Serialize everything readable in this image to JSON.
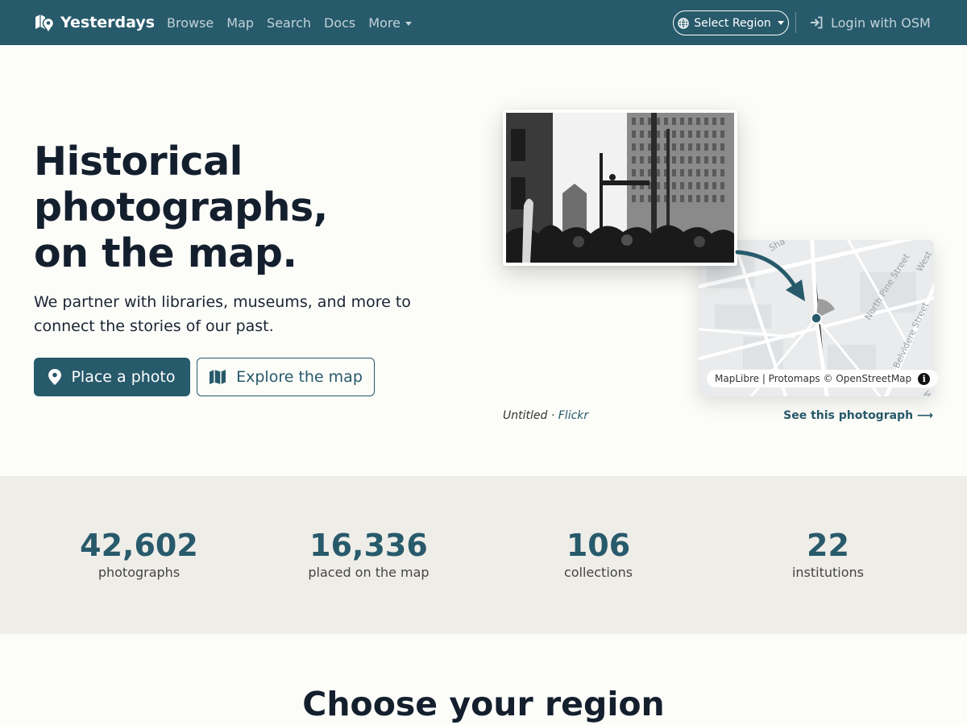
{
  "navbar": {
    "brand": "Yesterdays",
    "links": [
      "Browse",
      "Map",
      "Search",
      "Docs",
      "More"
    ],
    "region_button": "Select Region",
    "login": "Login with OSM"
  },
  "hero": {
    "title_line1": "Historical",
    "title_line2": "photographs,",
    "title_line3": "on the map.",
    "subtitle": "We partner with libraries, museums, and more to connect the stories of our past.",
    "primary_button": "Place a photo",
    "secondary_button": "Explore the map"
  },
  "feature": {
    "photo_title": "Untitled",
    "separator": " · ",
    "source": "Flickr",
    "see_link": "See this photograph ⟶",
    "map_attribution": "MapLibre | Protomaps © OpenStreetMap",
    "street_labels": [
      "North Pine Street",
      "Belvidere Street",
      "West",
      "West",
      "Sha"
    ]
  },
  "stats": [
    {
      "value": "42,602",
      "label": "photographs"
    },
    {
      "value": "16,336",
      "label": "placed on the map"
    },
    {
      "value": "106",
      "label": "collections"
    },
    {
      "value": "22",
      "label": "institutions"
    }
  ],
  "regions": {
    "title": "Choose your region"
  },
  "colors": {
    "brand": "#275a6b",
    "background": "#fcfcf9",
    "stats_band": "#efede8"
  }
}
